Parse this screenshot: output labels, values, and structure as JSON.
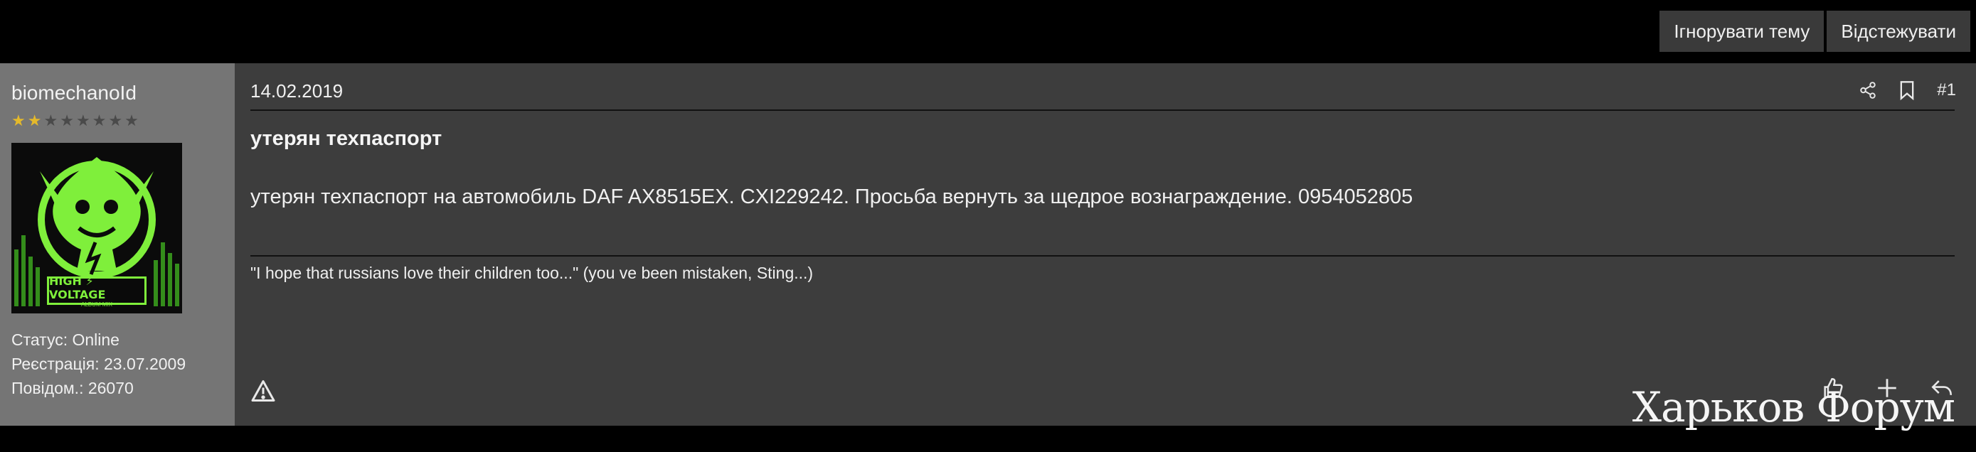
{
  "top_actions": {
    "ignore_label": "Ігнорувати тему",
    "watch_label": "Відстежувати"
  },
  "user": {
    "name": "biomechanoId",
    "rating_stars": 2,
    "rating_max": 8,
    "avatar": {
      "badge_line1": "HIGH ⚡ VOLTAGE",
      "badge_line2": "ALBUM MIX"
    },
    "status": "Статус: Online",
    "registered": "Реєстрація: 23.07.2009",
    "posts": "Повідом.: 26070"
  },
  "post": {
    "date": "14.02.2019",
    "number": "#1",
    "title": "утерян техпаспорт",
    "body": "утерян техпаспорт на автомобиль DAF AX8515EX. CXI229242. Просьба вернуть за щедрое вознаграждение. 0954052805",
    "signature": "\"I hope that russians love their children too...\" (you ve been mistaken, Sting...)"
  },
  "watermark": "Харьков Форум",
  "icons": {
    "share": "share-icon",
    "bookmark": "bookmark-icon",
    "report": "warning-icon",
    "like": "thumbs-up-icon",
    "multiquote": "plus-icon",
    "reply": "reply-icon"
  },
  "colors": {
    "page_bg": "#000000",
    "user_panel_bg": "#757575",
    "post_bg": "#3d3d3d",
    "button_bg": "#3a3a3a",
    "star_on": "#e4b92b",
    "avatar_accent": "#7fef3b"
  }
}
